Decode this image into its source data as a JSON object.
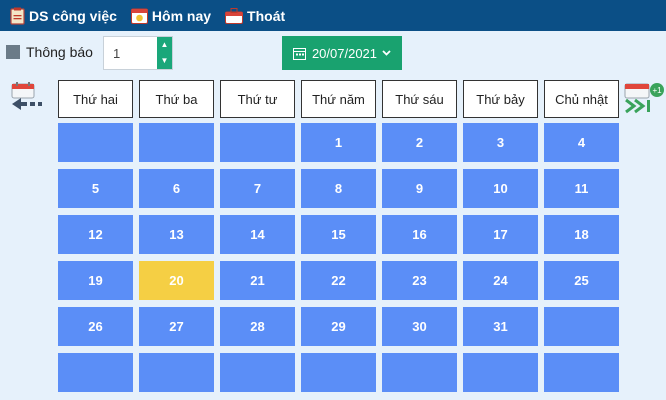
{
  "toolbar": {
    "tasks_label": "DS công việc",
    "today_label": "Hôm nay",
    "exit_label": "Thoát"
  },
  "notify": {
    "label": "Thông báo"
  },
  "stepper": {
    "value": "1"
  },
  "date_picker": {
    "value": "20/07/2021"
  },
  "next_badge": "+1",
  "weekdays": [
    "Thứ hai",
    "Thứ ba",
    "Thứ tư",
    "Thứ năm",
    "Thứ sáu",
    "Thứ bảy",
    "Chủ nhật"
  ],
  "days": [
    "",
    "",
    "",
    "1",
    "2",
    "3",
    "4",
    "5",
    "6",
    "7",
    "8",
    "9",
    "10",
    "11",
    "12",
    "13",
    "14",
    "15",
    "16",
    "17",
    "18",
    "19",
    "20",
    "21",
    "22",
    "23",
    "24",
    "25",
    "26",
    "27",
    "28",
    "29",
    "30",
    "31",
    "",
    "",
    "",
    "",
    "",
    "",
    "",
    ""
  ],
  "today_day": "20",
  "colors": {
    "topbar": "#0b4f86",
    "cell": "#5b8ef7",
    "today": "#f5cf44",
    "accent": "#19a26f"
  }
}
